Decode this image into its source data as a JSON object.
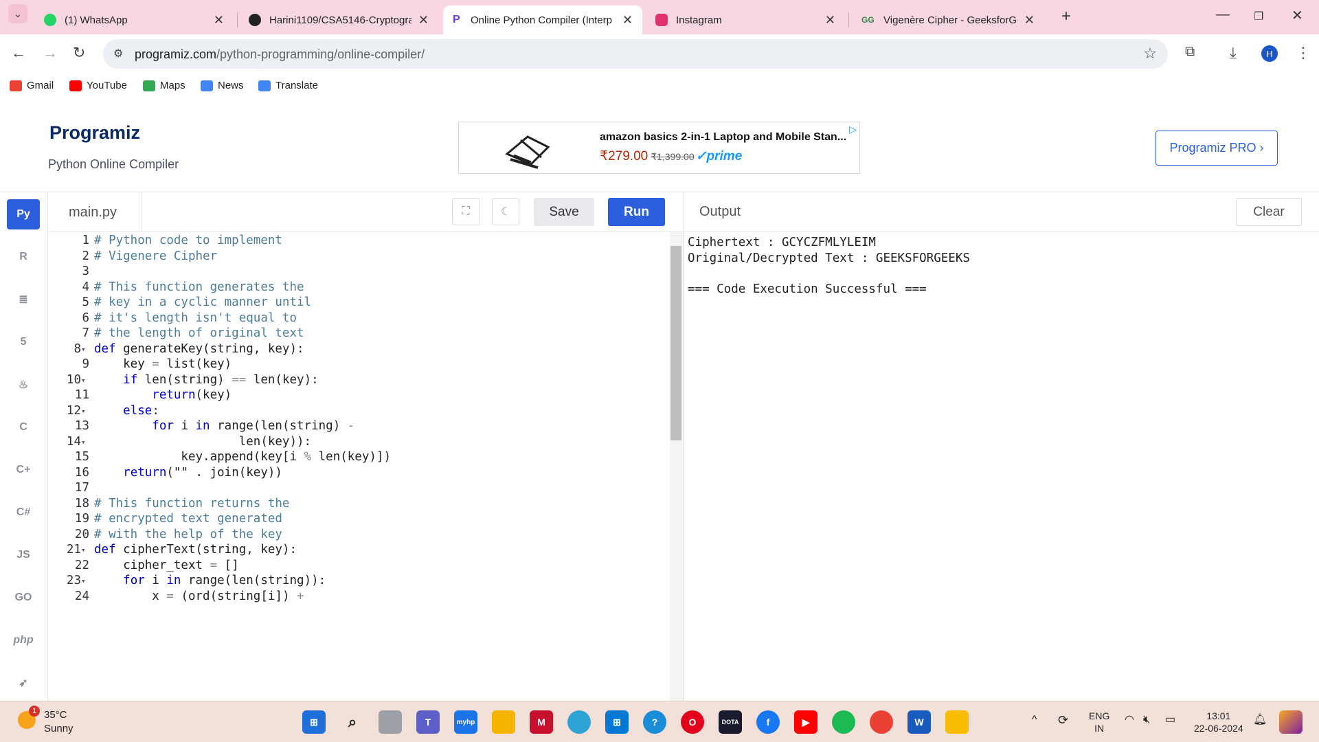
{
  "browser": {
    "tabs": [
      {
        "title": "(1) WhatsApp",
        "icon": "whatsapp-icon",
        "active": false
      },
      {
        "title": "Harini1109/CSA5146-Cryptogra",
        "icon": "github-icon",
        "active": false
      },
      {
        "title": "Online Python Compiler (Interp",
        "icon": "programiz-icon",
        "active": true
      },
      {
        "title": "Instagram",
        "icon": "instagram-icon",
        "active": false
      },
      {
        "title": "Vigenère Cipher - GeeksforGee",
        "icon": "geeksforgeeks-icon",
        "active": false
      }
    ],
    "url_domain": "programiz.com",
    "url_path": "/python-programming/online-compiler/",
    "profile_initial": "H",
    "bookmarks": [
      {
        "label": "Gmail",
        "color": "#ea4335"
      },
      {
        "label": "YouTube",
        "color": "#ff0000"
      },
      {
        "label": "Maps",
        "color": "#34a853"
      },
      {
        "label": "News",
        "color": "#4285f4"
      },
      {
        "label": "Translate",
        "color": "#4285f4"
      }
    ]
  },
  "site": {
    "logo": "Programiz",
    "subtitle": "Python Online Compiler",
    "ad": {
      "title": "amazon basics 2-in-1 Laptop and Mobile Stan...",
      "price": "₹279.00",
      "old_price": "₹1,399.00",
      "prime": "✓prime"
    },
    "pro_button": "Programiz PRO ›"
  },
  "sidebar": {
    "languages": [
      "python",
      "r",
      "sql",
      "html",
      "java",
      "c",
      "cpp",
      "csharp",
      "JS",
      "GO",
      "php",
      "swift"
    ]
  },
  "editor": {
    "filename": "main.py",
    "save_label": "Save",
    "run_label": "Run",
    "lines": [
      "# Python code to implement",
      "# Vigenere Cipher",
      "",
      "# This function generates the",
      "# key in a cyclic manner until",
      "# it's length isn't equal to",
      "# the length of original text",
      "def generateKey(string, key):",
      "    key = list(key)",
      "    if len(string) == len(key):",
      "        return(key)",
      "    else:",
      "        for i in range(len(string) -",
      "                    len(key)):",
      "            key.append(key[i % len(key)])",
      "    return(\"\" . join(key))",
      "",
      "# This function returns the",
      "# encrypted text generated",
      "# with the help of the key",
      "def cipherText(string, key):",
      "    cipher_text = []",
      "    for i in range(len(string)):",
      "        x = (ord(string[i]) +"
    ],
    "fold_lines": [
      8,
      10,
      12,
      14,
      21,
      23
    ]
  },
  "output": {
    "label": "Output",
    "clear_label": "Clear",
    "lines": [
      "Ciphertext : GCYCZFMLYLEIM",
      "Original/Decrypted Text : GEEKSFORGEEKS",
      "",
      "=== Code Execution Successful ==="
    ]
  },
  "taskbar": {
    "temperature": "35°C",
    "condition": "Sunny",
    "weather_badge": "1",
    "lang_top": "ENG",
    "lang_bottom": "IN",
    "time": "13:01",
    "date": "22-06-2024"
  }
}
